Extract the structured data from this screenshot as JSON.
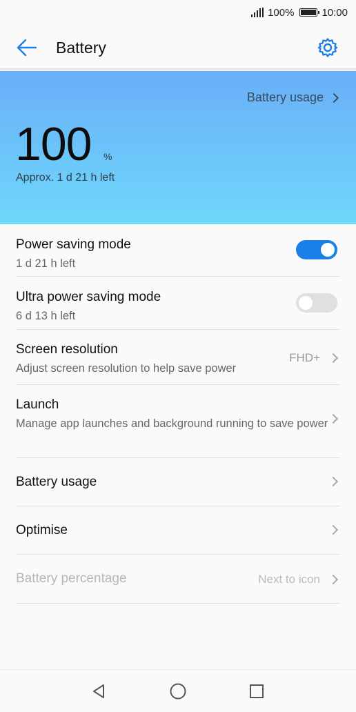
{
  "status_bar": {
    "battery_text": "100%",
    "time": "10:00"
  },
  "app_bar": {
    "title": "Battery",
    "back_icon": "arrow-left-icon",
    "settings_icon": "gear-icon",
    "accent": "#1a7fe6"
  },
  "hero": {
    "usage_link": "Battery usage",
    "percent": "100",
    "percent_symbol": "%",
    "time_left": "Approx. 1 d 21 h left",
    "gradient_top": "#6aaef8",
    "gradient_bottom": "#6fd8fb"
  },
  "list": {
    "power_saving": {
      "title": "Power saving mode",
      "sub": "1 d 21 h left",
      "enabled": true
    },
    "ultra_power_saving": {
      "title": "Ultra power saving mode",
      "sub": "6 d 13 h left",
      "enabled": false
    },
    "screen_resolution": {
      "title": "Screen resolution",
      "sub": "Adjust screen resolution to help save power",
      "value": "FHD+"
    },
    "launch": {
      "title": "Launch",
      "sub": "Manage app launches and background running to save power"
    },
    "battery_usage": {
      "title": "Battery usage"
    },
    "optimise": {
      "title": "Optimise"
    },
    "battery_percentage": {
      "title": "Battery percentage",
      "value": "Next to icon"
    }
  },
  "nav_bar": {
    "back_icon": "triangle-back-icon",
    "home_icon": "circle-home-icon",
    "recents_icon": "square-recents-icon"
  }
}
